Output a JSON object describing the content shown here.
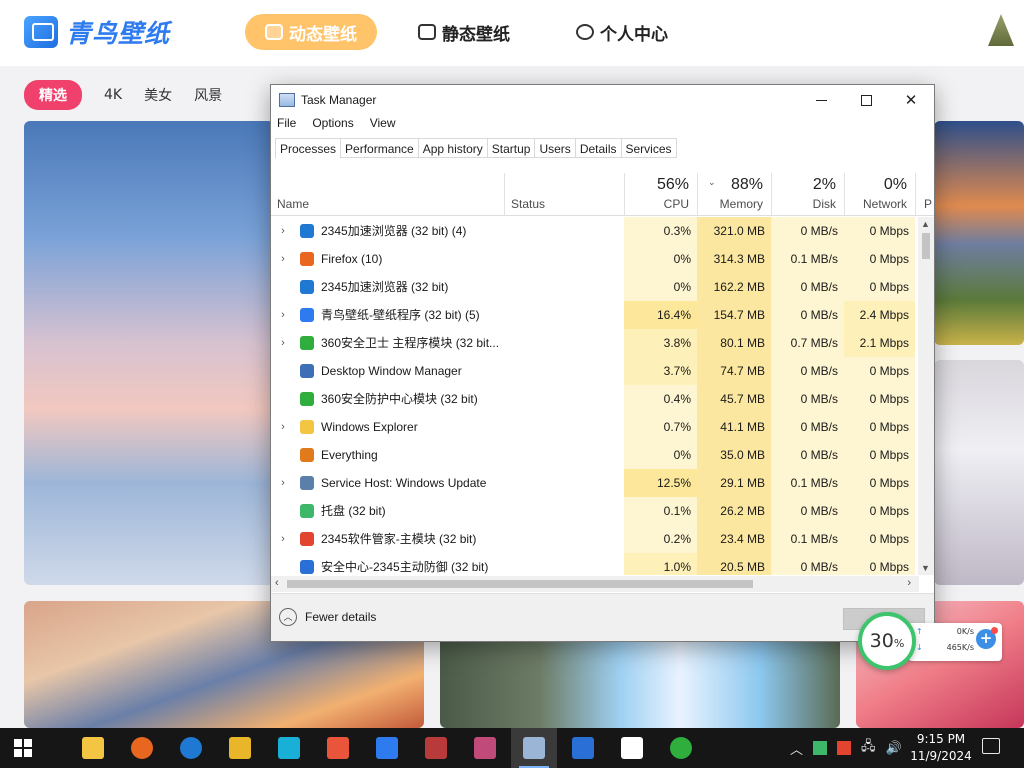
{
  "app": {
    "logo_text": "青鸟壁纸",
    "nav": {
      "dynamic": "动态壁纸",
      "static": "静态壁纸",
      "user": "个人中心"
    },
    "categories": [
      "精选",
      "4K",
      "美女",
      "风景"
    ]
  },
  "taskmgr": {
    "title": "Task Manager",
    "menu": [
      "File",
      "Options",
      "View"
    ],
    "tabs": [
      "Processes",
      "Performance",
      "App history",
      "Startup",
      "Users",
      "Details",
      "Services"
    ],
    "columns": {
      "name": "Name",
      "status": "Status",
      "cpu": {
        "pct": "56%",
        "label": "CPU"
      },
      "memory": {
        "pct": "88%",
        "label": "Memory"
      },
      "disk": {
        "pct": "2%",
        "label": "Disk"
      },
      "network": {
        "pct": "0%",
        "label": "Network"
      },
      "power": "P"
    },
    "rows": [
      {
        "name": "2345加速浏览器 (32 bit) (4)",
        "cpu": "0.3%",
        "mem": "321.0 MB",
        "disk": "0 MB/s",
        "net": "0 Mbps",
        "expandable": true,
        "icon": "ie-icon",
        "icon_color": "#1f78d1"
      },
      {
        "name": "Firefox (10)",
        "cpu": "0%",
        "mem": "314.3 MB",
        "disk": "0.1 MB/s",
        "net": "0 Mbps",
        "expandable": true,
        "icon": "firefox-icon",
        "icon_color": "#e8661f"
      },
      {
        "name": "2345加速浏览器 (32 bit)",
        "cpu": "0%",
        "mem": "162.2 MB",
        "disk": "0 MB/s",
        "net": "0 Mbps",
        "expandable": false,
        "icon": "ie-icon",
        "icon_color": "#1f78d1"
      },
      {
        "name": "青鸟壁纸-壁纸程序 (32 bit) (5)",
        "cpu": "16.4%",
        "mem": "154.7 MB",
        "disk": "0 MB/s",
        "net": "2.4 Mbps",
        "expandable": true,
        "icon": "wallpaper-icon",
        "icon_color": "#2d7bef"
      },
      {
        "name": "360安全卫士 主程序模块 (32 bit...",
        "cpu": "3.8%",
        "mem": "80.1 MB",
        "disk": "0.7 MB/s",
        "net": "2.1 Mbps",
        "expandable": true,
        "icon": "360-icon",
        "icon_color": "#2fae3e"
      },
      {
        "name": "Desktop Window Manager",
        "cpu": "3.7%",
        "mem": "74.7 MB",
        "disk": "0 MB/s",
        "net": "0 Mbps",
        "expandable": false,
        "icon": "dwm-icon",
        "icon_color": "#3c6fb6"
      },
      {
        "name": "360安全防护中心模块 (32 bit)",
        "cpu": "0.4%",
        "mem": "45.7 MB",
        "disk": "0 MB/s",
        "net": "0 Mbps",
        "expandable": false,
        "icon": "360-icon",
        "icon_color": "#2fae3e"
      },
      {
        "name": "Windows Explorer",
        "cpu": "0.7%",
        "mem": "41.1 MB",
        "disk": "0 MB/s",
        "net": "0 Mbps",
        "expandable": true,
        "icon": "folder-icon",
        "icon_color": "#f4c542"
      },
      {
        "name": "Everything",
        "cpu": "0%",
        "mem": "35.0 MB",
        "disk": "0 MB/s",
        "net": "0 Mbps",
        "expandable": false,
        "icon": "search-icon",
        "icon_color": "#e07a1a"
      },
      {
        "name": "Service Host: Windows Update",
        "cpu": "12.5%",
        "mem": "29.1 MB",
        "disk": "0.1 MB/s",
        "net": "0 Mbps",
        "expandable": true,
        "icon": "gear-icon",
        "icon_color": "#5a7fa8"
      },
      {
        "name": "托盘 (32 bit)",
        "cpu": "0.1%",
        "mem": "26.2 MB",
        "disk": "0 MB/s",
        "net": "0 Mbps",
        "expandable": false,
        "icon": "tray-icon",
        "icon_color": "#3db86b"
      },
      {
        "name": "2345软件管家-主模块 (32 bit)",
        "cpu": "0.2%",
        "mem": "23.4 MB",
        "disk": "0.1 MB/s",
        "net": "0 Mbps",
        "expandable": true,
        "icon": "software-icon",
        "icon_color": "#e2452f"
      },
      {
        "name": "安全中心-2345主动防御 (32 bit)",
        "cpu": "1.0%",
        "mem": "20.5 MB",
        "disk": "0 MB/s",
        "net": "0 Mbps",
        "expandable": false,
        "icon": "shield-icon",
        "icon_color": "#2a6fd6"
      }
    ],
    "fewer_details": "Fewer details"
  },
  "widget": {
    "percent": "30",
    "unit": "%",
    "upload": "0K/s",
    "download": "465K/s"
  },
  "taskbar": {
    "apps": [
      {
        "name": "file-explorer-icon",
        "color": "#f4c542"
      },
      {
        "name": "firefox-icon",
        "color": "#e8661f"
      },
      {
        "name": "ie-icon",
        "color": "#1f78d1"
      },
      {
        "name": "picture-app-icon",
        "color": "#e9b62a"
      },
      {
        "name": "p-app-icon",
        "color": "#19b0d8"
      },
      {
        "name": "color-app-icon",
        "color": "#e9553a"
      },
      {
        "name": "wallpaper-icon",
        "color": "#2d7bef"
      },
      {
        "name": "archive-icon",
        "color": "#b83a3a"
      },
      {
        "name": "archive2-icon",
        "color": "#c04a7a"
      },
      {
        "name": "task-manager-icon",
        "color": "#9bb5d6"
      },
      {
        "name": "shield-icon",
        "color": "#2a6fd6"
      },
      {
        "name": "user-app-icon",
        "color": "#ffffff"
      },
      {
        "name": "360-icon",
        "color": "#2fae3e"
      }
    ],
    "time": "9:15 PM",
    "date": "11/9/2024"
  }
}
